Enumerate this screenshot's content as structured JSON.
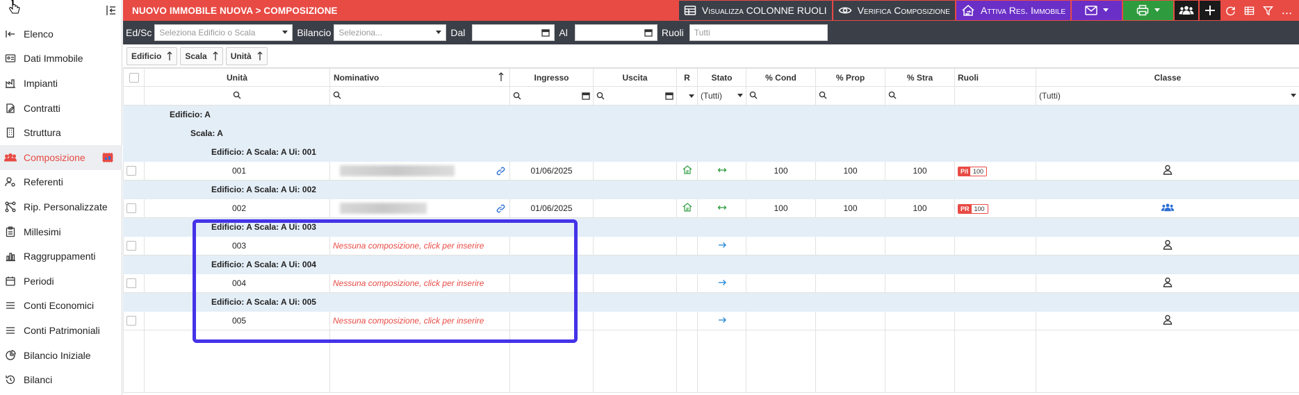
{
  "header": {
    "title": "NUOVO IMMOBILE NUOVA > COMPOSIZIONE",
    "btn_columns": "Visualizza COLONNE RUOLI",
    "btn_verify": "Verifica Composizione",
    "btn_activate": "Attiva Res. Immobile"
  },
  "sidebar": {
    "items": [
      {
        "label": "Elenco",
        "icon": "log-in-icon"
      },
      {
        "label": "Dati Immobile",
        "icon": "id-card-icon"
      },
      {
        "label": "Impianti",
        "icon": "factory-icon"
      },
      {
        "label": "Contratti",
        "icon": "contract-edit-icon"
      },
      {
        "label": "Struttura",
        "icon": "building-icon"
      },
      {
        "label": "Composizione",
        "icon": "users-icon"
      },
      {
        "label": "Referenti",
        "icon": "user-settings-icon"
      },
      {
        "label": "Rip. Personalizzate",
        "icon": "network-icon"
      },
      {
        "label": "Millesimi",
        "icon": "clipboard-icon"
      },
      {
        "label": "Raggruppamenti",
        "icon": "bar-chart-icon"
      },
      {
        "label": "Periodi",
        "icon": "calendar-icon"
      },
      {
        "label": "Conti Economici",
        "icon": "list-icon"
      },
      {
        "label": "Conti Patrimoniali",
        "icon": "list-icon"
      },
      {
        "label": "Bilancio Iniziale",
        "icon": "pie-chart-icon"
      },
      {
        "label": "Bilanci",
        "icon": "history-icon"
      }
    ]
  },
  "filters": {
    "edsc_label": "Ed/Sc",
    "edsc_placeholder": "Seleziona Edificio o Scala",
    "bilancio_label": "Bilancio",
    "bilancio_placeholder": "Seleziona...",
    "dal_label": "Dal",
    "al_label": "Al",
    "ruoli_label": "Ruoli",
    "ruoli_placeholder": "Tutti"
  },
  "sort": {
    "chips": [
      "Edificio",
      "Scala",
      "Unità"
    ]
  },
  "table": {
    "headers": {
      "unita": "Unità",
      "nominativo": "Nominativo",
      "ingresso": "Ingresso",
      "uscita": "Uscita",
      "r": "R",
      "stato": "Stato",
      "cond": "% Cond",
      "prop": "% Prop",
      "stra": "% Stra",
      "ruoli": "Ruoli",
      "classe": "Classe"
    },
    "filter_stato": "(Tutti)",
    "filter_classe": "(Tutti)",
    "group_edificio": "Edificio: A",
    "group_scala": "Scala: A",
    "rows": [
      {
        "group": "Edificio: A Scala: A Ui: 001",
        "unita": "001",
        "ingresso": "01/06/2025",
        "cond": "100",
        "prop": "100",
        "stra": "100",
        "badge_l": "P/I",
        "badge_r": "100"
      },
      {
        "group": "Edificio: A Scala: A Ui: 002",
        "unita": "002",
        "ingresso": "01/06/2025",
        "cond": "100",
        "prop": "100",
        "stra": "100",
        "badge_l": "PR",
        "badge_r": "100"
      },
      {
        "group": "Edificio: A Scala: A Ui: 003",
        "unita": "003",
        "msg": "Nessuna composizione, click per inserire"
      },
      {
        "group": "Edificio: A Scala: A Ui: 004",
        "unita": "004",
        "msg": "Nessuna composizione, click per inserire"
      },
      {
        "group": "Edificio: A Scala: A Ui: 005",
        "unita": "005",
        "msg": "Nessuna composizione, click per inserire"
      }
    ]
  },
  "colors": {
    "accent": "#e84a44",
    "dark": "#3b3f48",
    "purple": "#6a2fc7",
    "green": "#2e9c3e",
    "highlight": "#4433e8"
  }
}
